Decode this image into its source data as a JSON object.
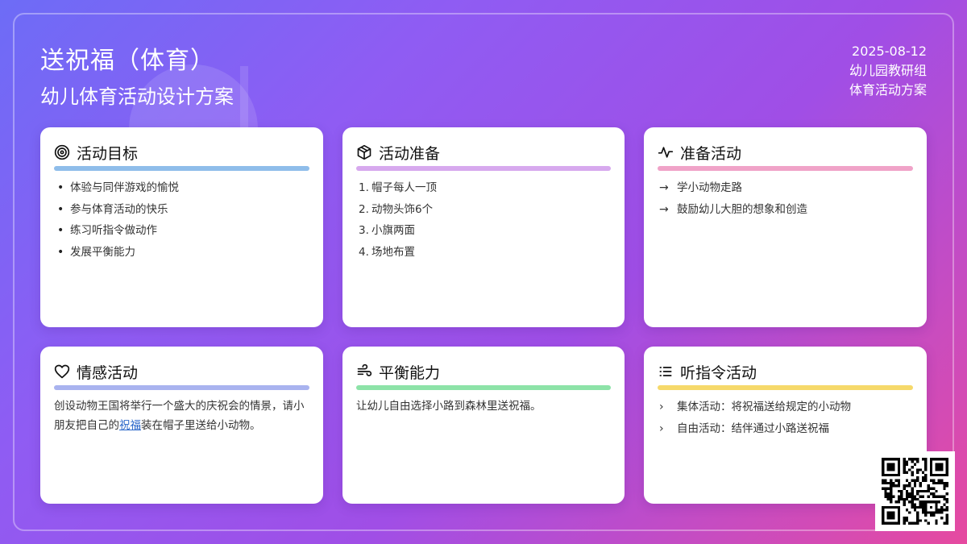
{
  "header": {
    "title": "送祝福（体育）",
    "subtitle": "幼儿体育活动设计方案"
  },
  "meta": {
    "date": "2025-08-12",
    "group": "幼儿园教研组",
    "type": "体育活动方案"
  },
  "cards": {
    "goals": {
      "title": "活动目标",
      "icon": "target-icon",
      "accent": "#8fbdea",
      "items": [
        "体验与同伴游戏的愉悦",
        "参与体育活动的快乐",
        "练习听指令做动作",
        "发展平衡能力"
      ]
    },
    "prep": {
      "title": "活动准备",
      "icon": "box-icon",
      "accent": "#d7a9ee",
      "items": [
        {
          "num": "1.",
          "text": "帽子每人一顶"
        },
        {
          "num": "2.",
          "text": "动物头饰6个"
        },
        {
          "num": "3.",
          "text": "小旗两面"
        },
        {
          "num": "4.",
          "text": "场地布置"
        }
      ]
    },
    "warmup": {
      "title": "准备活动",
      "icon": "activity-icon",
      "accent": "#f0a3c8",
      "items": [
        "学小动物走路",
        "鼓励幼儿大胆的想象和创造"
      ]
    },
    "emotion": {
      "title": "情感活动",
      "icon": "heart-icon",
      "accent": "#a9b3ef",
      "text_before": "创设动物王国将举行一个盛大的庆祝会的情景，请小朋友把自己的",
      "link": "祝福",
      "text_after": "装在帽子里送给小动物。"
    },
    "balance": {
      "title": "平衡能力",
      "icon": "wind-icon",
      "accent": "#8de3a8",
      "text": "让幼儿自由选择小路到森林里送祝福。"
    },
    "listen": {
      "title": "听指令活动",
      "icon": "list-icon",
      "accent": "#f6d96a",
      "items": [
        "集体活动：将祝福送给规定的小动物",
        "自由活动：结伴通过小路送祝福"
      ]
    }
  }
}
